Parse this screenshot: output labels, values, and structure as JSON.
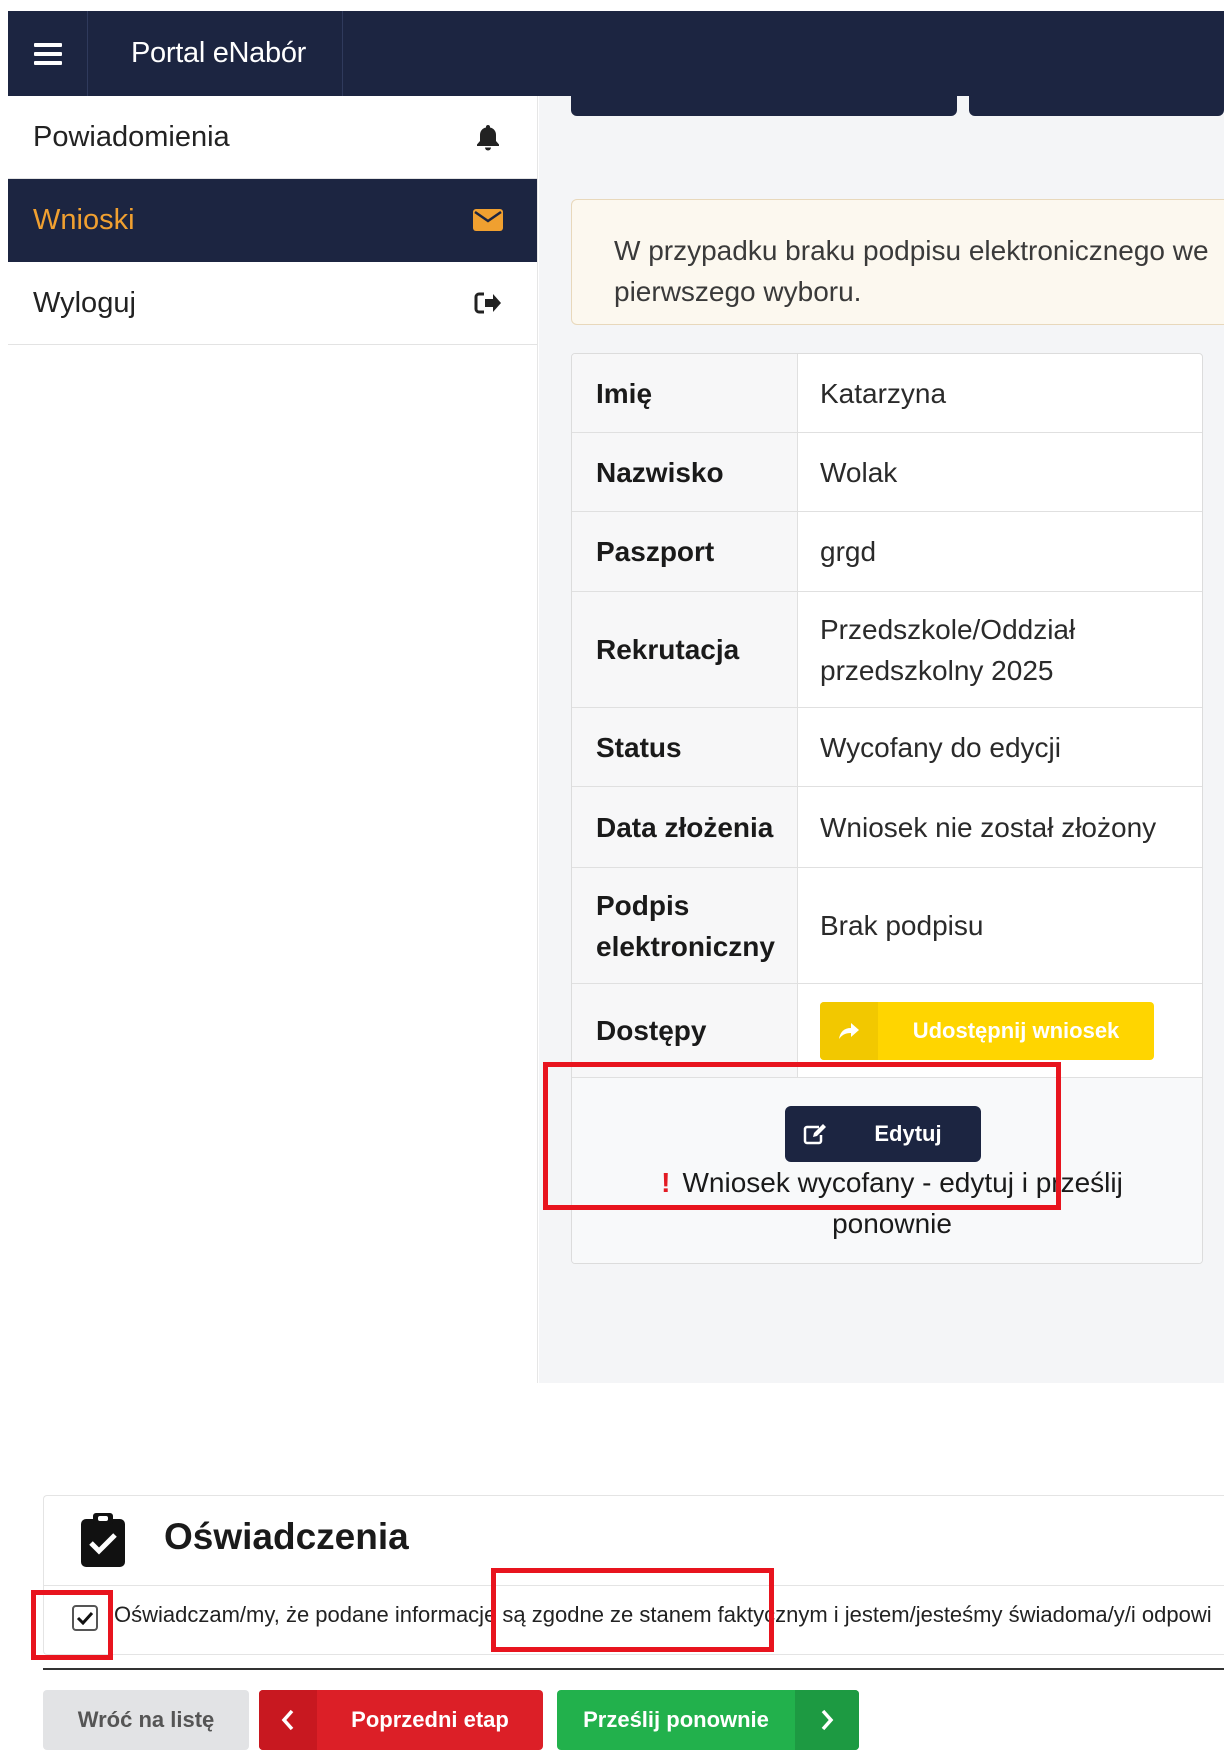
{
  "header": {
    "brand": "Portal eNabór"
  },
  "sidebar": {
    "items": [
      {
        "label": "Powiadomienia",
        "icon": "bell-icon"
      },
      {
        "label": "Wnioski",
        "icon": "envelope-icon",
        "active": true
      },
      {
        "label": "Wyloguj",
        "icon": "sign-out-icon"
      }
    ]
  },
  "alert": {
    "line1": "W przypadku braku podpisu elektronicznego we",
    "line2": "pierwszego wyboru."
  },
  "details": {
    "rows": [
      {
        "label": "Imię",
        "value": "Katarzyna"
      },
      {
        "label": "Nazwisko",
        "value": "Wolak"
      },
      {
        "label": "Paszport",
        "value": "grgd"
      },
      {
        "label": "Rekrutacja",
        "value_line1": "Przedszkole/Oddział",
        "value_line2": "przedszkolny 2025"
      },
      {
        "label": "Status",
        "value": "Wycofany do edycji"
      },
      {
        "label": "Data złożenia",
        "value": "Wniosek nie został złożony"
      },
      {
        "label_line1": "Podpis",
        "label_line2": "elektroniczny",
        "value": "Brak podpisu"
      },
      {
        "label": "Dostępy",
        "button": "Udostępnij wniosek"
      }
    ],
    "edit_button": "Edytuj",
    "withdrawn_message_line1": "Wniosek wycofany - edytuj i prześlij",
    "withdrawn_message_line2": "ponownie"
  },
  "declarations": {
    "title": "Oświadczenia",
    "checkbox_checked": true,
    "text": "Oświadczam/my, że podane informacje są zgodne ze stanem faktycznym i jestem/jesteśmy świadoma/y/i odpowi"
  },
  "footer_buttons": {
    "back": "Wróć na listę",
    "previous": "Poprzedni etap",
    "resend": "Prześlij ponownie"
  },
  "colors": {
    "navy": "#1c2541",
    "active_text": "#f0a030",
    "yellow": "#ffd500",
    "red": "#dc1f27",
    "green": "#22b14c",
    "highlight": "#e8141e"
  }
}
